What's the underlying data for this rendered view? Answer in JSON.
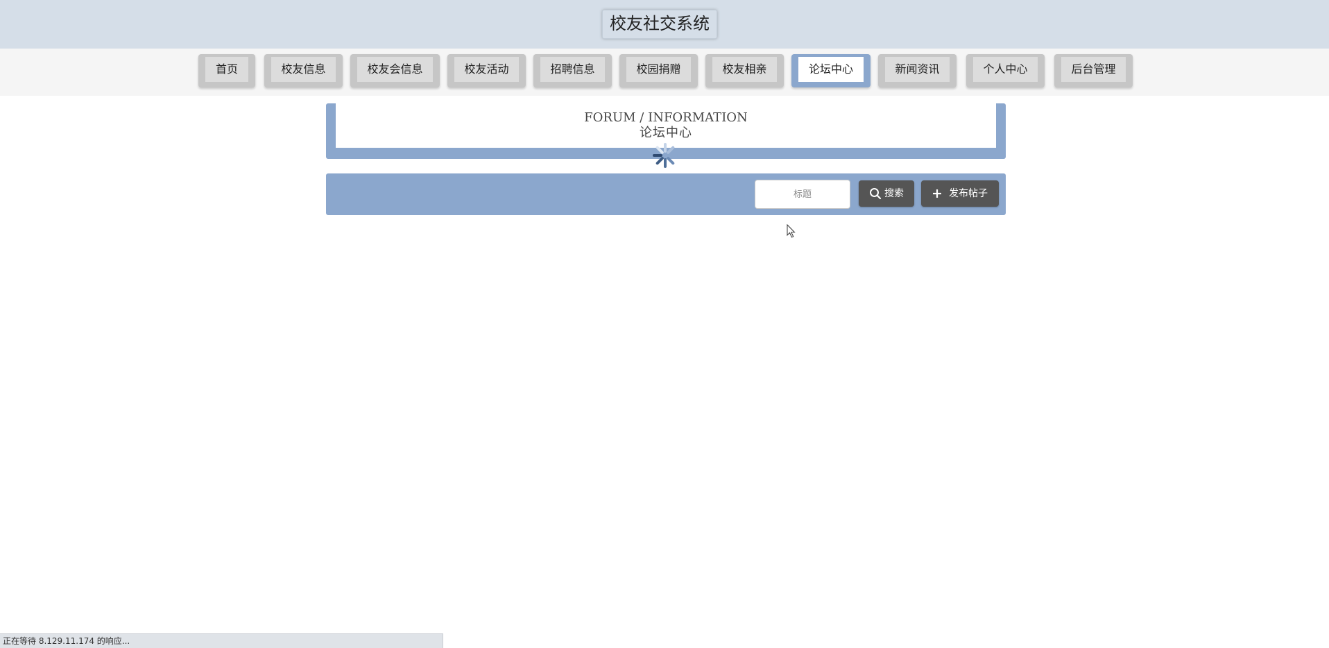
{
  "site": {
    "title": "校友社交系统"
  },
  "nav": {
    "items": [
      {
        "label": "首页",
        "active": false
      },
      {
        "label": "校友信息",
        "active": false
      },
      {
        "label": "校友会信息",
        "active": false
      },
      {
        "label": "校友活动",
        "active": false
      },
      {
        "label": "招聘信息",
        "active": false
      },
      {
        "label": "校园捐赠",
        "active": false
      },
      {
        "label": "校友相亲",
        "active": false
      },
      {
        "label": "论坛中心",
        "active": true
      },
      {
        "label": "新闻资讯",
        "active": false
      },
      {
        "label": "个人中心",
        "active": false
      },
      {
        "label": "后台管理",
        "active": false
      }
    ]
  },
  "forum": {
    "title_en": "FORUM / INFORMATION",
    "title_zh": "论坛中心"
  },
  "search": {
    "placeholder": "标题",
    "value": "",
    "search_label": "搜索",
    "post_label": "发布帖子"
  },
  "icons": {
    "search": "search-icon",
    "post": "plus-icon",
    "loading": "loading-spinner-icon"
  },
  "status_bar": {
    "text": "正在等待 8.129.11.174 的响应..."
  },
  "colors": {
    "header_bg": "#d5dee8",
    "accent": "#8ba7cd",
    "nav_bg": "#c6c6c6",
    "button_bg": "#555555"
  }
}
